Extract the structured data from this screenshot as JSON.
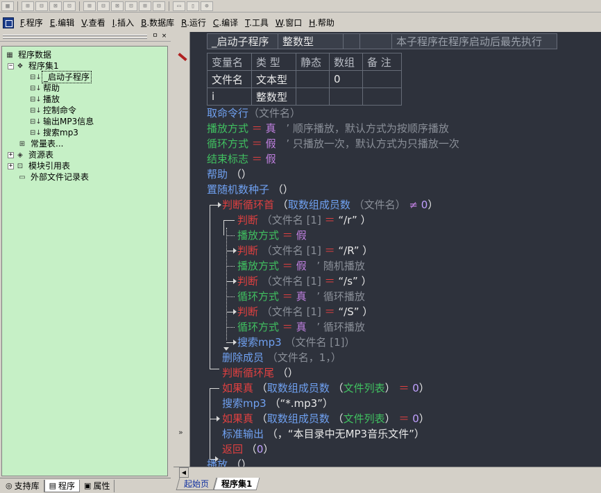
{
  "menubar": {
    "items": [
      {
        "key": "F",
        "label": ".程序"
      },
      {
        "key": "E",
        "label": ".编辑"
      },
      {
        "key": "V",
        "label": ".查看"
      },
      {
        "key": "I",
        "label": ".插入"
      },
      {
        "key": "B",
        "label": ".数据库"
      },
      {
        "key": "R",
        "label": ".运行"
      },
      {
        "key": "C",
        "label": ".编译"
      },
      {
        "key": "T",
        "label": ".工具"
      },
      {
        "key": "W",
        "label": ".窗口"
      },
      {
        "key": "H",
        "label": ".帮助"
      }
    ]
  },
  "leftpanel": {
    "pin_label": "ㅁ",
    "close_label": "×",
    "tree": [
      {
        "label": "程序数据",
        "icon": "data-icon"
      },
      {
        "label": "程序集1",
        "icon": "assembly-icon",
        "expander": "−"
      },
      {
        "label": "_启动子程序",
        "icon": "sub-icon",
        "selected": true
      },
      {
        "label": "帮助",
        "icon": "sub-icon"
      },
      {
        "label": "播放",
        "icon": "sub-icon"
      },
      {
        "label": "控制命令",
        "icon": "sub-icon"
      },
      {
        "label": "输出MP3信息",
        "icon": "sub-icon"
      },
      {
        "label": "搜索mp3",
        "icon": "sub-icon"
      },
      {
        "label": "常量表...",
        "icon": "const-icon"
      },
      {
        "label": "资源表",
        "icon": "resource-icon",
        "expander": "+"
      },
      {
        "label": "模块引用表",
        "icon": "module-icon",
        "expander": "+"
      },
      {
        "label": "外部文件记录表",
        "icon": "file-icon"
      }
    ],
    "tabs": [
      {
        "label": "支持库",
        "icon": "library-icon"
      },
      {
        "label": "程序",
        "icon": "program-icon"
      },
      {
        "label": "属性",
        "icon": "property-icon"
      }
    ]
  },
  "editor": {
    "header": {
      "sub_name": "_启动子程序",
      "return_type": "整数型",
      "comment": "本子程序在程序启动后最先执行"
    },
    "var_table": {
      "headers": [
        "变量名",
        "类 型",
        "静态",
        "数组",
        "备 注"
      ],
      "rows": [
        [
          "文件名",
          "文本型",
          "",
          "0",
          ""
        ],
        [
          "i",
          "整数型",
          "",
          "",
          ""
        ]
      ]
    },
    "lines": [
      "取命令行",
      "（文件名）",
      "播放方式",
      "＝",
      "真",
      "’ 顺序播放，默认方式为按顺序播放",
      "循环方式",
      "＝",
      "假",
      "’ 只播放一次，默认方式为只播放一次",
      "结束标志",
      "＝",
      "假",
      "帮助",
      "（）",
      "置随机数种子",
      "（）",
      "判断循环首",
      "（",
      "取数组成员数",
      "（文件名）",
      "≠",
      "0",
      "）",
      "判断",
      "（文件名 [1]",
      "＝",
      "“/r”",
      "）",
      "播放方式",
      "＝",
      "假",
      "判断",
      "（文件名 [1]",
      "＝",
      "“/R”",
      "）",
      "播放方式",
      "＝",
      "假",
      "’ 随机播放",
      "判断",
      "（文件名 [1]",
      "＝",
      "“/s”",
      "）",
      "循环方式",
      "＝",
      "真",
      "’ 循环播放",
      "判断",
      "（文件名 [1]",
      "＝",
      "“/S”",
      "）",
      "循环方式",
      "＝",
      "真",
      "’ 循环播放",
      "搜索mp3",
      "（文件名 [1]）",
      "删除成员",
      "（文件名，1，）",
      "判断循环尾",
      "（）",
      "如果真",
      "（",
      "取数组成员数",
      "（",
      "文件列表",
      "）",
      "＝",
      "0",
      "）",
      "搜索mp3",
      "（“*.mp3”）",
      "如果真",
      "（",
      "取数组成员数",
      "（",
      "文件列表",
      "）",
      "＝",
      "0",
      "）",
      "标准输出",
      "（，“本目录中无MP3音乐文件”）",
      "返回",
      "（",
      "0",
      "）",
      "播放",
      "（）"
    ],
    "tabs": [
      "起始页",
      "程序集1"
    ]
  },
  "colors": {
    "editor_bg": "#2e323c",
    "keyword_blue": "#6fa0f0",
    "flow_red": "#e04040",
    "var_green": "#40c060",
    "const_purple": "#c080e0",
    "comment_gray": "#8a8f98",
    "tree_bg": "#c6f0c6"
  }
}
